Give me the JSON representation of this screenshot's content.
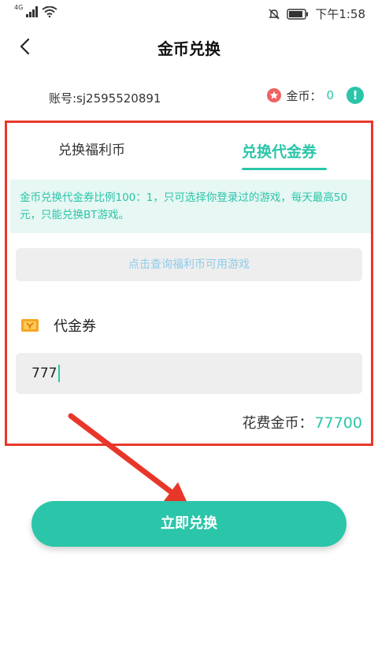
{
  "status_bar": {
    "network": "4G",
    "time": "下午1:58"
  },
  "header": {
    "title": "金币兑换",
    "back_icon": "chevron-left-icon"
  },
  "account": {
    "account_text": "账号:sj2595520891",
    "coin_label": "金币：",
    "coin_value": "0"
  },
  "tabs": [
    {
      "label": "兑换福利币",
      "active": false
    },
    {
      "label": "兑换代金券",
      "active": true
    }
  ],
  "notice": "金币兑换代金券比例100：1，只可选择你登录过的游戏，每天最高50元，只能兑换BT游戏。",
  "query_button": "点击查询福利币可用游戏",
  "voucher": {
    "label": "代金券",
    "input_value": "777"
  },
  "cost": {
    "label": "花费金币：",
    "value": "77700"
  },
  "submit_button": "立即兑换",
  "colors": {
    "accent": "#2bc5a9",
    "annotation_red": "#e8372a",
    "notice_bg": "#e7f7f3"
  }
}
